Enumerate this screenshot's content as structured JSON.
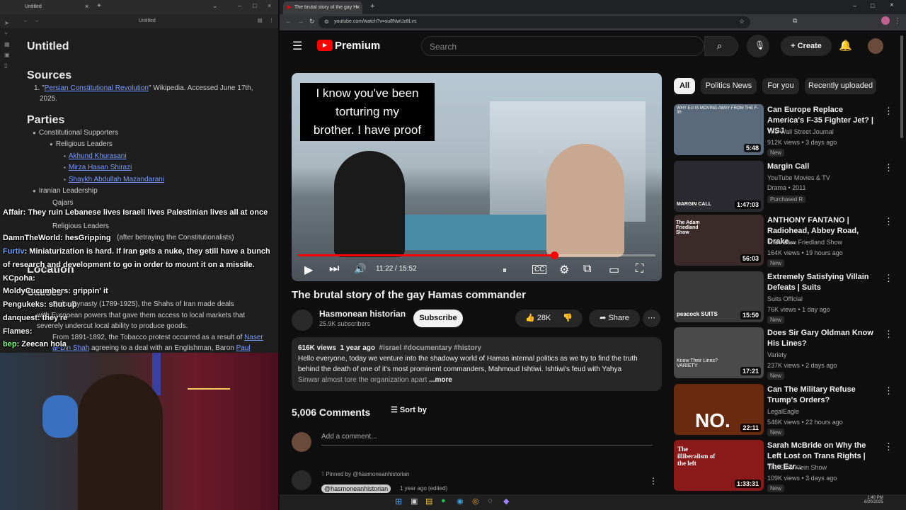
{
  "left_app": {
    "tab_title": "Untitled",
    "center_title": "Untitled",
    "doc_title": "Untitled",
    "sources_heading": "Sources",
    "source_line1_link": "Persian Constitutional Revolution",
    "source_line1_rest": "\" Wikipedia. Accessed June 17th,",
    "source_line2": "2025.",
    "parties_heading": "Parties",
    "constitutional_supporters": "Constitutional Supporters",
    "religious_leaders": "Religious Leaders",
    "leader1": "Akhund Khurasani",
    "leader2": "Mirza Hasan Shirazi",
    "leader3": "Shaykh Abdullah Mazandarani",
    "iranian_leadership": "Iranian Leadership",
    "qajars": "Qajars",
    "religious_leaders2": "Religious Leaders",
    "after_betraying": "(after betraying the Constitutionalists)",
    "location_heading": "Location",
    "causes_heading": "Causes",
    "causes_line1": "Qajar Dynasty (1789-1925), the Shahs of Iran made deals",
    "causes_line2": "with European powers that gave them access to local markets that",
    "causes_line3": "severely undercut local ability to produce goods.",
    "causes_line4": "From 1891-1892, the Tobacco protest occurred as a result of",
    "causes_link1": "Naser",
    "causes_line5_link": "al-Din Shah",
    "causes_line5_rest": "agreeing to a deal with an Englishman, Baron",
    "causes_link2": "Paul"
  },
  "chat": [
    {
      "user": "Affair",
      "text": "They ruin Lebanese lives Israeli lives Palestinian lives all at once"
    },
    {
      "user": "DamnTheWorld",
      "text": "hesGripping"
    },
    {
      "user": "Furtiv",
      "text": "Miniaturization is hard. If Iran gets a nuke, they still have a bunch"
    },
    {
      "user": "",
      "text": "of research and development to go in order to mount it on a missile."
    },
    {
      "user": "KCpoha",
      "text": ""
    },
    {
      "user": "MoldyCucumbers",
      "text": "grippin' it"
    },
    {
      "user": "Pengukeks",
      "text": "shut up"
    },
    {
      "user": "danquest",
      "text": "they're"
    },
    {
      "user": "Flames",
      "text": ""
    },
    {
      "user": "bep",
      "text": "Zeecan hola"
    }
  ],
  "browser": {
    "tab_title": "The brutal story of the gay Ham...",
    "url": "youtube.com/watch?v=su8NwUz8Lvs"
  },
  "youtube": {
    "logo": "Premium",
    "search_placeholder": "Search",
    "create": "Create",
    "video": {
      "caption_line1": "I know you've been",
      "caption_line2": "torturing my",
      "caption_line3": "brother. I have proof",
      "time": "11:22 / 15:52",
      "progress_fraction": 0.716,
      "title": "The brutal story of the gay Hamas commander",
      "channel": "Hasmonean historian",
      "subscribers": "25.9K subscribers",
      "subscribe": "Subscribe",
      "likes": "28K",
      "share": "Share",
      "views": "616K views",
      "age": "1 year ago",
      "tags": "#israel #documentary #history",
      "desc_line1": "Hello everyone, today we venture into the shadowy world of Hamas internal politics as we try to find the truth",
      "desc_line2": "behind the death of one of it's most prominent commanders, Mahmoud Ishtiwi. Ishtiwi's feud with Yahya",
      "desc_line3": "Sinwar almost tore the organization apart",
      "more": "...more"
    },
    "comments": {
      "count": "5,006 Comments",
      "sort": "Sort by",
      "add": "Add a comment...",
      "pinned": "Pinned by @hasmoneanhistorian",
      "first_author": "@hasmoneanhistorian",
      "first_age": "1 year ago (edited)"
    },
    "chips": [
      "All",
      "Politics News",
      "For you",
      "Recently uploaded"
    ],
    "recs": [
      {
        "title": "Can Europe Replace America's F-35 Fighter Jet? | WSJ",
        "channel": "The Wall Street Journal",
        "meta": "912K views • 3 days ago",
        "badge": "New",
        "duration": "5:48",
        "thumb_text": "WHY EU IS MOVING AWAY FROM THE F-35",
        "color": "#5a6a7a"
      },
      {
        "title": "Margin Call",
        "channel": "YouTube Movies & TV",
        "meta": "Drama • 2011",
        "badge": "Purchased   R",
        "duration": "1:47:03",
        "thumb_text": "MARGIN CALL",
        "color": "#2a2a30"
      },
      {
        "title": "ANTHONY FANTANO | Radiohead, Abbey Road, Drake...",
        "channel": "The Adam Friedland Show",
        "meta": "164K views • 19 hours ago",
        "badge": "New",
        "duration": "56:03",
        "thumb_text": "The Adam Friedland Show",
        "color": "#3a2a2a"
      },
      {
        "title": "Extremely Satisfying Villain Defeats | Suits",
        "channel": "Suits Official",
        "meta": "76K views • 1 day ago",
        "badge": "New",
        "duration": "15:50",
        "thumb_text": "peacock SUITS",
        "color": "#3a3a3a"
      },
      {
        "title": "Does Sir Gary Oldman Know His Lines?",
        "channel": "Variety",
        "meta": "237K views • 2 days ago",
        "badge": "New",
        "duration": "17:21",
        "thumb_text": "Know Their Lines? VARIETY",
        "color": "#4a4a4a"
      },
      {
        "title": "Can The Military Refuse Trump's Orders?",
        "channel": "LegalEagle",
        "meta": "546K views • 22 hours ago",
        "badge": "New",
        "duration": "22:11",
        "thumb_text": "NO.",
        "color": "#6a2a10"
      },
      {
        "title": "Sarah McBride on Why the Left Lost on Trans Rights | The Ezr...",
        "channel": "The Ezra Klein Show",
        "meta": "109K views • 3 days ago",
        "badge": "New",
        "duration": "1:33:31",
        "thumb_text": "The illiberalism of the left",
        "color": "#8a1a1a"
      }
    ]
  },
  "taskbar": {
    "time": "1:40 PM",
    "date": "6/20/2025"
  }
}
